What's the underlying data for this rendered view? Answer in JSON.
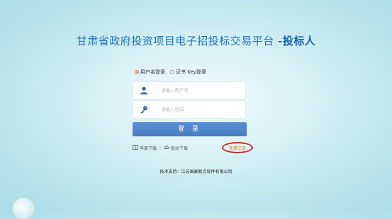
{
  "header": {
    "title": "甘肃省政府投资项目电子招投标交易平台",
    "role_suffix": "-投标人"
  },
  "login_mode": {
    "options": [
      {
        "label": "用户名登录",
        "selected": true
      },
      {
        "label": "证书 Key登录",
        "selected": false
      }
    ]
  },
  "form": {
    "username_placeholder": "请输入用户名",
    "password_placeholder": "请输入密码",
    "username_icon": "user-icon",
    "password_icon": "key-icon"
  },
  "login_button": {
    "label": "登 录"
  },
  "links": {
    "manual_download": "手册下载",
    "driver_download": "驱动下载",
    "register": "免费注册"
  },
  "footer": {
    "support": "技术支持：江苏国泰新点软件有限公司"
  },
  "colors": {
    "title": "#1f73b7",
    "button": "#4f84c8",
    "register_text": "#e9822d",
    "annotation_circle": "#d42a1f"
  }
}
